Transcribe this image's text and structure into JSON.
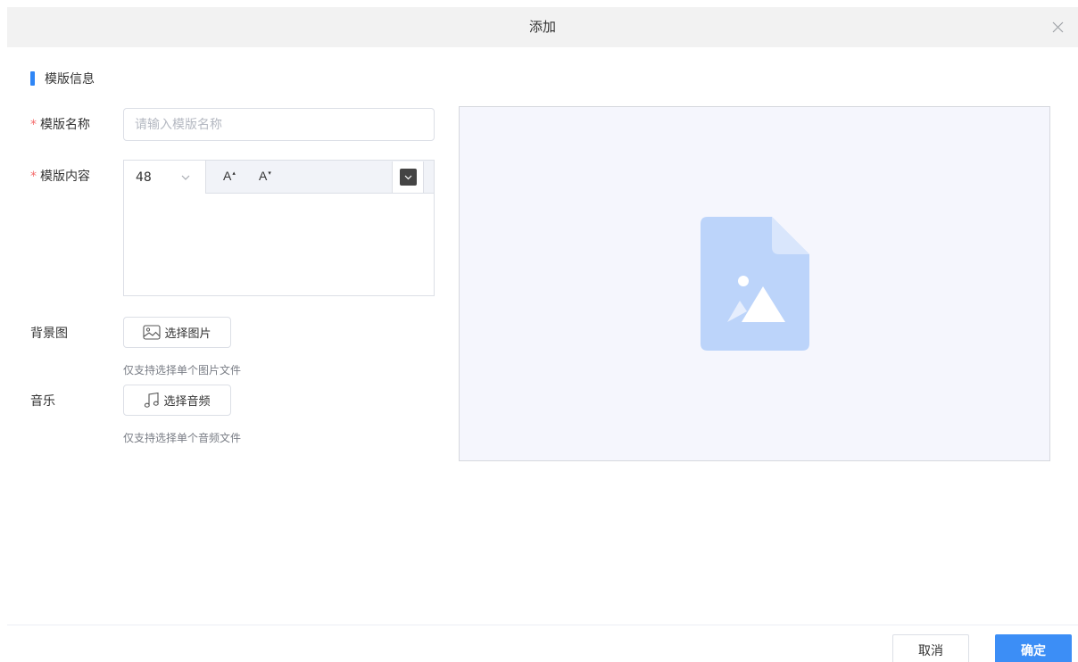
{
  "dialog": {
    "title": "添加",
    "close_icon": "close-icon"
  },
  "section": {
    "title": "模版信息",
    "accent_color": "#2f86f6"
  },
  "form": {
    "required_mark": "*",
    "name": {
      "label": "模版名称",
      "value": "",
      "placeholder": "请输入模版名称"
    },
    "content": {
      "label": "模版内容",
      "font_size": "48",
      "increase_font_label": "A",
      "decrease_font_label": "A",
      "text_color": "#444444",
      "value": ""
    },
    "background": {
      "label": "背景图",
      "button_label": "选择图片",
      "button_icon": "image-icon",
      "hint": "仅支持选择单个图片文件"
    },
    "music": {
      "label": "音乐",
      "button_label": "选择音频",
      "button_icon": "music-note-icon",
      "hint": "仅支持选择单个音频文件"
    }
  },
  "preview": {
    "icon": "image-file-placeholder-icon",
    "background_color": "#f5f6fd",
    "icon_color": "#bcd4fa"
  },
  "footer": {
    "cancel_label": "取消",
    "ok_label": "确定",
    "primary_color": "#3c8ef6"
  }
}
